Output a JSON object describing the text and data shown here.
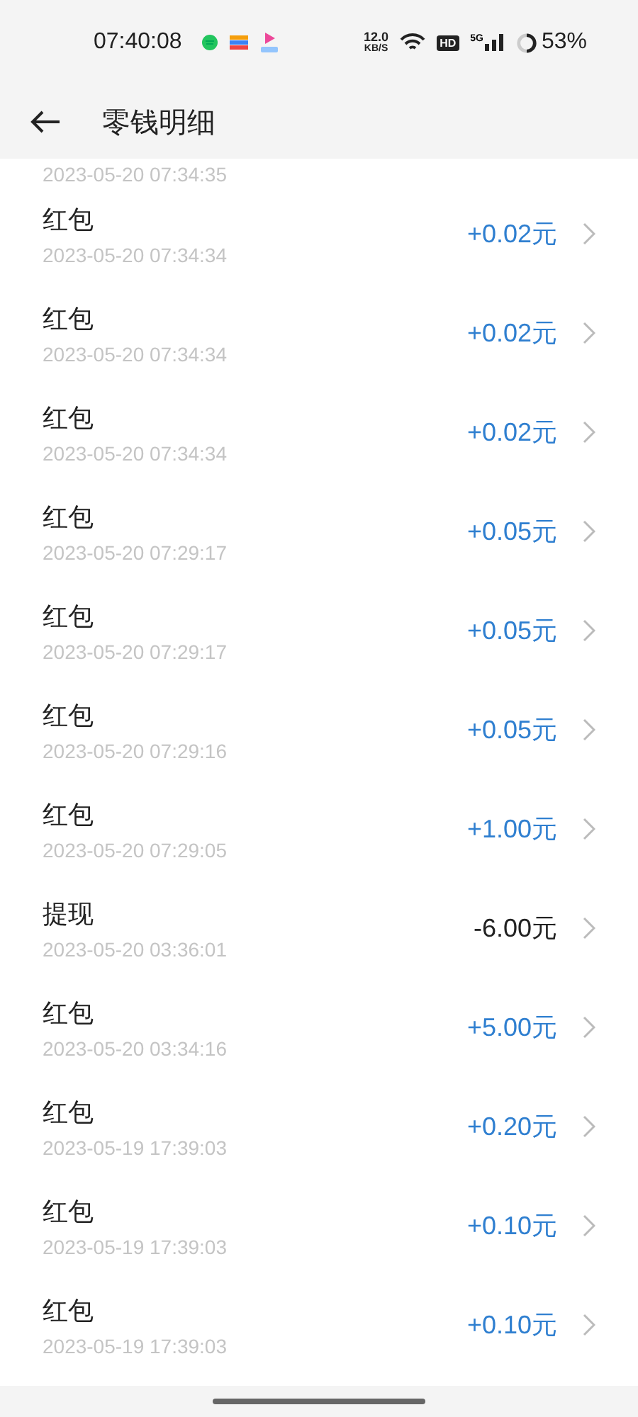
{
  "status_bar": {
    "time": "07:40:08",
    "net_speed": "12.0",
    "net_unit": "KB/S",
    "hd": "HD",
    "network": "5G",
    "battery": "53%"
  },
  "header": {
    "title": "零钱明细"
  },
  "partial_row": {
    "date": "2023-05-20 07:34:35"
  },
  "rows": [
    {
      "title": "红包",
      "date": "2023-05-20 07:34:34",
      "amount": "+0.02元",
      "kind": "income"
    },
    {
      "title": "红包",
      "date": "2023-05-20 07:34:34",
      "amount": "+0.02元",
      "kind": "income"
    },
    {
      "title": "红包",
      "date": "2023-05-20 07:34:34",
      "amount": "+0.02元",
      "kind": "income"
    },
    {
      "title": "红包",
      "date": "2023-05-20 07:29:17",
      "amount": "+0.05元",
      "kind": "income"
    },
    {
      "title": "红包",
      "date": "2023-05-20 07:29:17",
      "amount": "+0.05元",
      "kind": "income"
    },
    {
      "title": "红包",
      "date": "2023-05-20 07:29:16",
      "amount": "+0.05元",
      "kind": "income"
    },
    {
      "title": "红包",
      "date": "2023-05-20 07:29:05",
      "amount": "+1.00元",
      "kind": "income"
    },
    {
      "title": "提现",
      "date": "2023-05-20 03:36:01",
      "amount": "-6.00元",
      "kind": "expense"
    },
    {
      "title": "红包",
      "date": "2023-05-20 03:34:16",
      "amount": "+5.00元",
      "kind": "income"
    },
    {
      "title": "红包",
      "date": "2023-05-19 17:39:03",
      "amount": "+0.20元",
      "kind": "income"
    },
    {
      "title": "红包",
      "date": "2023-05-19 17:39:03",
      "amount": "+0.10元",
      "kind": "income"
    },
    {
      "title": "红包",
      "date": "2023-05-19 17:39:03",
      "amount": "+0.10元",
      "kind": "income"
    }
  ]
}
